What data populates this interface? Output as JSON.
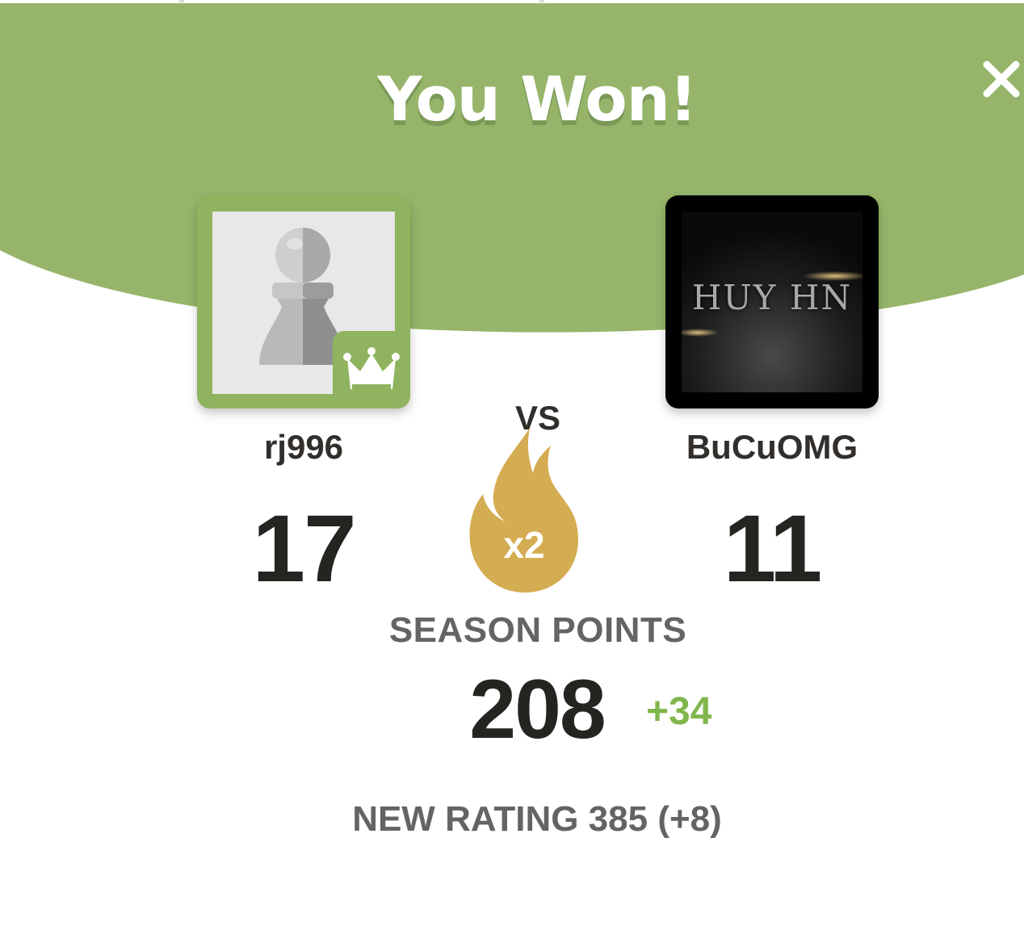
{
  "modal": {
    "title": "You Won!",
    "close_icon": "close-icon"
  },
  "players": {
    "me": {
      "username": "rj996",
      "score": "17",
      "avatar_icon": "pawn-icon",
      "badge_icon": "crown-icon"
    },
    "opponent": {
      "username": "BuCuOMG",
      "score": "11",
      "avatar_text": "HUY HN"
    }
  },
  "match": {
    "vs_label": "VS",
    "multiplier_icon": "flame-icon",
    "multiplier_label": "x2"
  },
  "season": {
    "label": "SEASON POINTS",
    "value": "208",
    "delta": "+34"
  },
  "rating": {
    "text": "NEW RATING 385 (+8)"
  },
  "colors": {
    "header_green": "#96b56a",
    "accent_green": "#81b64c",
    "flame_gold": "#d4ac52",
    "text_dark": "#262421",
    "text_gray": "#666463"
  }
}
